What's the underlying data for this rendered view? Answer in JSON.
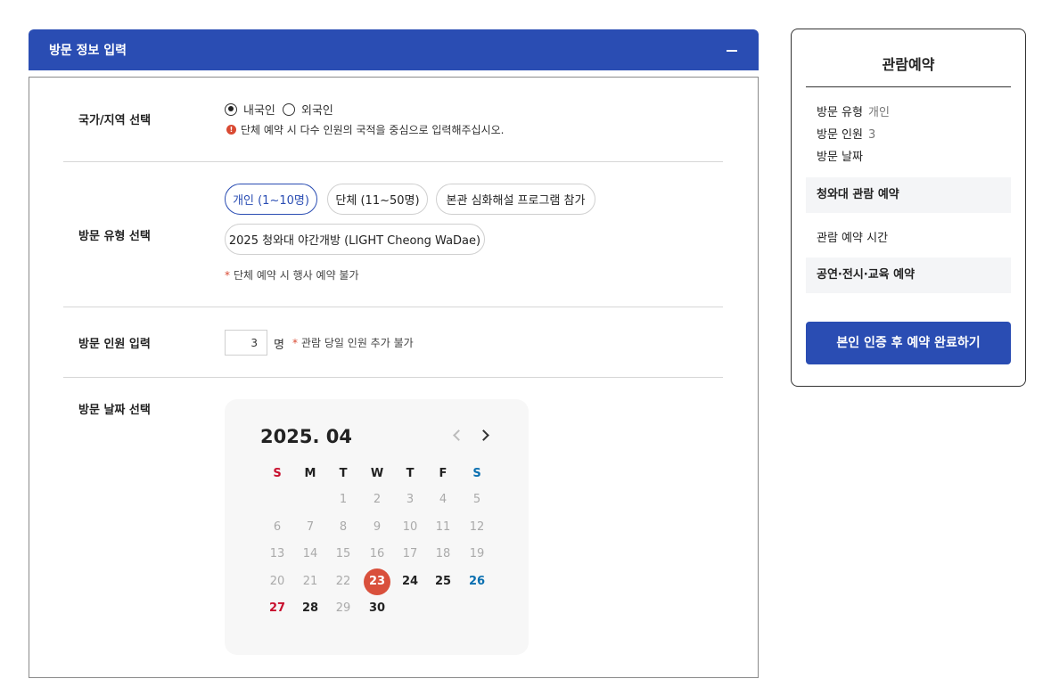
{
  "form": {
    "title": "방문 정보 입력",
    "collapse_icon": "minus-icon",
    "country": {
      "label": "국가/지역 선택",
      "options": [
        "내국인",
        "외국인"
      ],
      "selected": "내국인",
      "notice": "단체 예약 시 다수 인원의 국적을 중심으로 입력해주십시오."
    },
    "visit_type": {
      "label": "방문 유형 선택",
      "options": [
        "개인 (1~10명)",
        "단체 (11~50명)",
        "본관 심화해설 프로그램 참가",
        "2025 청와대 야간개방 (LIGHT Cheong WaDae)"
      ],
      "selected": "개인 (1~10명)",
      "note": "단체 예약 시 행사 예약 불가"
    },
    "visitors": {
      "label": "방문 인원 입력",
      "value": "3",
      "unit": "명",
      "note": "관람 당일 인원 추가 불가"
    },
    "date": {
      "label": "방문 날짜 선택"
    }
  },
  "calendar": {
    "month": "2025. 04",
    "weekdays": [
      "S",
      "M",
      "T",
      "W",
      "T",
      "F",
      "S"
    ],
    "days": [
      "1",
      "2",
      "3",
      "4",
      "5",
      "6",
      "7",
      "8",
      "9",
      "10",
      "11",
      "12",
      "13",
      "14",
      "15",
      "16",
      "17",
      "18",
      "19",
      "20",
      "21",
      "22",
      "23",
      "24",
      "25",
      "26",
      "27",
      "28",
      "29",
      "30"
    ],
    "today": "23",
    "accent_color": "#d9503c",
    "sunday_color": "#c8102e",
    "saturday_color": "#0a6fb0"
  },
  "summary": {
    "title": "관람예약",
    "items": [
      {
        "label": "방문 유형",
        "value": "개인"
      },
      {
        "label": "방문 인원",
        "value": "3"
      },
      {
        "label": "방문 날짜",
        "value": ""
      }
    ],
    "sections": [
      "청와대 관람 예약",
      "관람 예약 시간",
      "공연·전시·교육 예약"
    ],
    "cta": "본인 인증 후 예약 완료하기"
  },
  "colors": {
    "brand": "#2a4db3"
  }
}
